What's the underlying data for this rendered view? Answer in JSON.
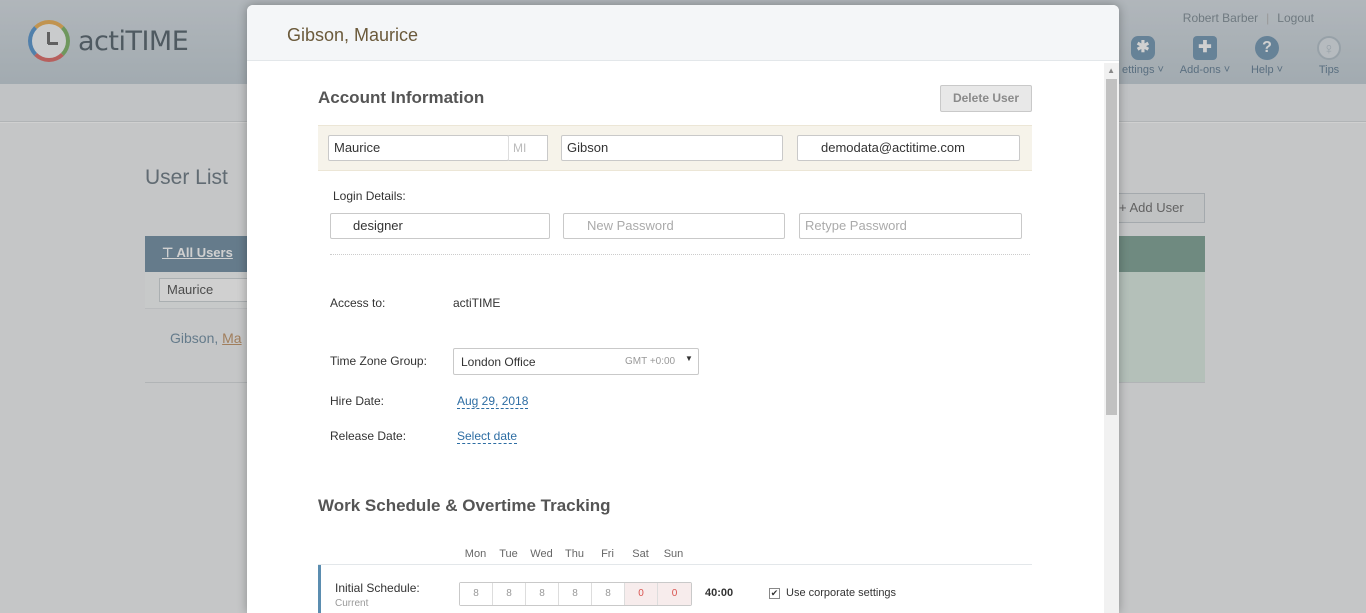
{
  "app": {
    "logo_text": "actiTIME"
  },
  "header": {
    "user_name": "Robert Barber",
    "separator": "|",
    "logout": "Logout",
    "icons": [
      {
        "label": "ettings ˅",
        "icon": "gear-icon"
      },
      {
        "label": "Add-ons ˅",
        "icon": "puzzle-icon"
      },
      {
        "label": "Help ˅",
        "icon": "help-icon"
      },
      {
        "label": "Tips",
        "icon": "bulb-icon"
      }
    ]
  },
  "background": {
    "page_title": "User List",
    "add_user": "Add User",
    "filter_label": "All Users",
    "search_value": "Maurice",
    "row_last": "Gibson, ",
    "row_first_partial": "Ma"
  },
  "modal": {
    "title": "Gibson, Maurice",
    "account_section_title": "Account Information",
    "delete_button": "Delete User",
    "first_name": "Maurice",
    "mi_placeholder": "MI",
    "last_name": "Gibson",
    "email": "demodata@actitime.com",
    "login_details_label": "Login Details:",
    "username": "designer",
    "new_password_placeholder": "New Password",
    "retype_password_placeholder": "Retype Password",
    "access_label": "Access to:",
    "access_value": "actiTIME",
    "timezone_label": "Time Zone Group:",
    "timezone_value": "London Office",
    "timezone_offset": "GMT +0:00",
    "hire_label": "Hire Date:",
    "hire_value": "Aug 29, 2018",
    "release_label": "Release Date:",
    "release_value": "Select date",
    "schedule_section_title": "Work Schedule & Overtime Tracking",
    "days": [
      "Mon",
      "Tue",
      "Wed",
      "Thu",
      "Fri",
      "Sat",
      "Sun"
    ],
    "schedule_label": "Initial Schedule:",
    "schedule_sub": "Current",
    "hours": [
      "8",
      "8",
      "8",
      "8",
      "8",
      "0",
      "0"
    ],
    "total": "40:00",
    "corporate_checkbox": "Use corporate settings",
    "corporate_checked": true
  }
}
